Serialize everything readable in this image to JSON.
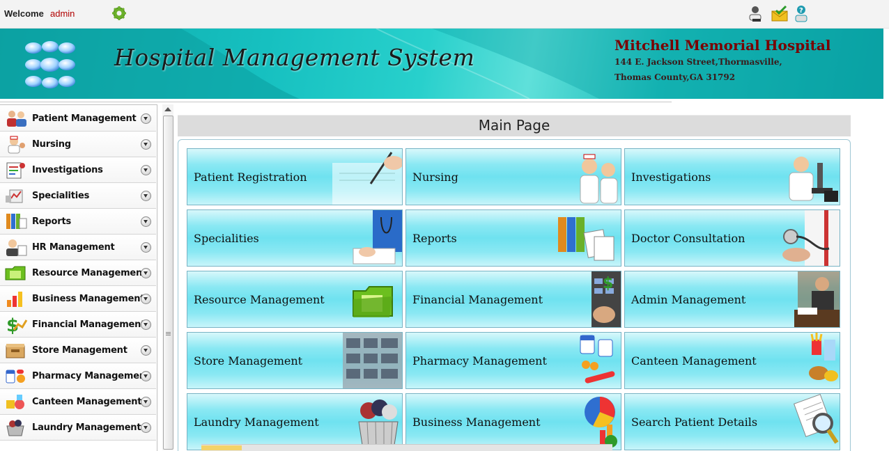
{
  "topbar": {
    "welcome_label": "Welcome",
    "username": "admin",
    "icons": [
      "gear-icon",
      "user-icon",
      "mail-icon",
      "help-icon"
    ]
  },
  "banner": {
    "title": "Hospital Management System",
    "hospital_name": "Mitchell Memorial Hospital",
    "address_line1": "144 E. Jackson Street,Thormasville,",
    "address_line2": "Thomas County,GA 31792"
  },
  "sidebar": {
    "items": [
      {
        "label": "Patient Management",
        "icon": "patient-icon"
      },
      {
        "label": "Nursing",
        "icon": "nurse-icon"
      },
      {
        "label": "Investigations",
        "icon": "investigation-icon"
      },
      {
        "label": "Specialities",
        "icon": "speciality-icon"
      },
      {
        "label": "Reports",
        "icon": "reports-icon"
      },
      {
        "label": "HR Management",
        "icon": "hr-icon"
      },
      {
        "label": "Resource Management",
        "icon": "folder-icon"
      },
      {
        "label": "Business Management",
        "icon": "business-chart-icon"
      },
      {
        "label": "Financial Management",
        "icon": "dollar-icon"
      },
      {
        "label": "Store Management",
        "icon": "store-icon"
      },
      {
        "label": "Pharmacy Management",
        "icon": "pharmacy-icon"
      },
      {
        "label": "Canteen Management",
        "icon": "canteen-icon"
      },
      {
        "label": "Laundry Management",
        "icon": "laundry-icon"
      }
    ]
  },
  "main": {
    "title": "Main Page",
    "tiles": [
      {
        "label": "Patient Registration",
        "icon": "pen-writing-icon"
      },
      {
        "label": "Nursing",
        "icon": "nurses-icon"
      },
      {
        "label": "Investigations",
        "icon": "microscope-icon"
      },
      {
        "label": "Specialities",
        "icon": "doctor-notes-icon"
      },
      {
        "label": "Reports",
        "icon": "binders-icon"
      },
      {
        "label": "Doctor Consultation",
        "icon": "stethoscope-icon"
      },
      {
        "label": "Resource Management",
        "icon": "folder-icon"
      },
      {
        "label": "Financial Management",
        "icon": "calculator-icon"
      },
      {
        "label": "Admin Management",
        "icon": "desk-icon"
      },
      {
        "label": "Store Management",
        "icon": "shelves-icon"
      },
      {
        "label": "Pharmacy Management",
        "icon": "medicine-icon"
      },
      {
        "label": "Canteen Management",
        "icon": "food-icon"
      },
      {
        "label": "Laundry Management",
        "icon": "laundry-basket-icon"
      },
      {
        "label": "Business Management",
        "icon": "pie-chart-icon"
      },
      {
        "label": "Search Patient Details",
        "icon": "magnifier-document-icon"
      }
    ]
  },
  "colors": {
    "banner_teal": "#16c0c0",
    "hospital_name": "#7a0000",
    "username": "#b00000",
    "tile_cyan": "#6fe2f0"
  }
}
